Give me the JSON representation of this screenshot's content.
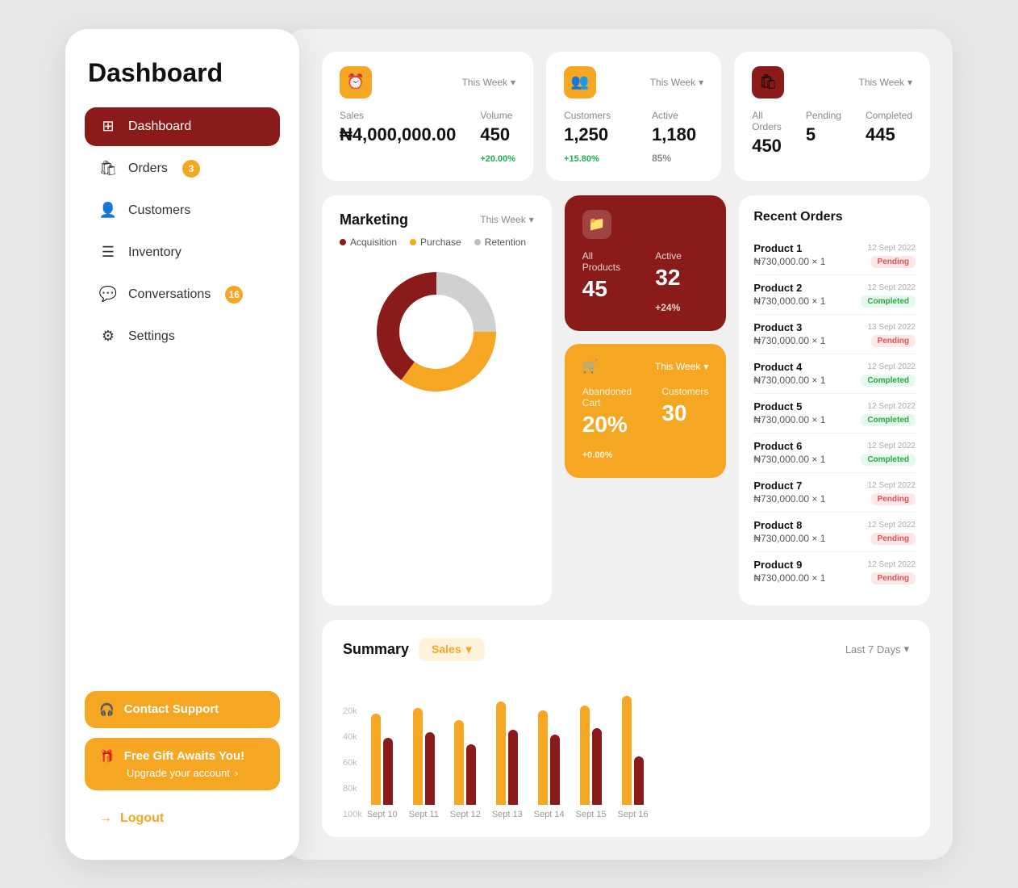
{
  "sidebar": {
    "title": "Dashboard",
    "nav_items": [
      {
        "id": "dashboard",
        "label": "Dashboard",
        "icon": "⊞",
        "active": true,
        "badge": null
      },
      {
        "id": "orders",
        "label": "Orders",
        "icon": "🛍",
        "active": false,
        "badge": "3"
      },
      {
        "id": "customers",
        "label": "Customers",
        "icon": "👤",
        "active": false,
        "badge": null
      },
      {
        "id": "inventory",
        "label": "Inventory",
        "icon": "☰",
        "active": false,
        "badge": null
      },
      {
        "id": "conversations",
        "label": "Conversations",
        "icon": "💬",
        "active": false,
        "badge": "16"
      },
      {
        "id": "settings",
        "label": "Settings",
        "icon": "⚙",
        "active": false,
        "badge": null
      }
    ],
    "contact_support_label": "Contact Support",
    "gift_title": "Free Gift Awaits You!",
    "gift_sub": "Upgrade your account",
    "gift_arrow": "›",
    "logout_label": "Logout"
  },
  "stats": {
    "sales_card": {
      "icon": "🕐",
      "period": "This Week",
      "sales_label": "Sales",
      "sales_value": "₦4,000,000.00",
      "volume_label": "Volume",
      "volume_value": "450",
      "volume_badge": "+20.00%"
    },
    "customers_card": {
      "icon": "👥",
      "period": "This Week",
      "customers_label": "Customers",
      "customers_value": "1,250",
      "customers_badge": "+15.80%",
      "active_label": "Active",
      "active_value": "1,180",
      "active_pct": "85%"
    },
    "orders_card": {
      "icon": "🛍",
      "period": "This Week",
      "all_orders_label": "All Orders",
      "all_orders_value": "450",
      "pending_label": "Pending",
      "pending_value": "5",
      "completed_label": "Completed",
      "completed_value": "445"
    }
  },
  "marketing": {
    "title": "Marketing",
    "period": "This Week",
    "legend": [
      {
        "label": "Acquisition",
        "color": "#8B1A1A"
      },
      {
        "label": "Purchase",
        "color": "#F5A623"
      },
      {
        "label": "Retention",
        "color": "#c0c0c0"
      }
    ],
    "donut": {
      "acquisition_pct": 40,
      "purchase_pct": 35,
      "retention_pct": 25
    }
  },
  "products_card": {
    "all_products_label": "All Products",
    "all_products_value": "45",
    "active_label": "Active",
    "active_value": "32",
    "active_badge": "+24%"
  },
  "abandoned_card": {
    "period": "This Week",
    "abandoned_label": "Abandoned Cart",
    "abandoned_value": "20%",
    "abandoned_badge": "+0.00%",
    "customers_label": "Customers",
    "customers_value": "30"
  },
  "recent_orders": {
    "title": "Recent Orders",
    "orders": [
      {
        "name": "Product 1",
        "price": "₦730,000.00 × 1",
        "date": "12 Sept 2022",
        "status": "Pending"
      },
      {
        "name": "Product 2",
        "price": "₦730,000.00 × 1",
        "date": "12 Sept 2022",
        "status": "Completed"
      },
      {
        "name": "Product 3",
        "price": "₦730,000.00 × 1",
        "date": "13 Sept 2022",
        "status": "Pending"
      },
      {
        "name": "Product 4",
        "price": "₦730,000.00 × 1",
        "date": "12 Sept 2022",
        "status": "Completed"
      },
      {
        "name": "Product 5",
        "price": "₦730,000.00 × 1",
        "date": "12 Sept 2022",
        "status": "Completed"
      },
      {
        "name": "Product 6",
        "price": "₦730,000.00 × 1",
        "date": "12 Sept 2022",
        "status": "Completed"
      },
      {
        "name": "Product 7",
        "price": "₦730,000.00 × 1",
        "date": "12 Sept 2022",
        "status": "Pending"
      },
      {
        "name": "Product 8",
        "price": "₦730,000.00 × 1",
        "date": "12 Sept 2022",
        "status": "Pending"
      },
      {
        "name": "Product 9",
        "price": "₦730,000.00 × 1",
        "date": "12 Sept 2022",
        "status": "Pending"
      }
    ]
  },
  "summary": {
    "title": "Summary",
    "tab_label": "Sales",
    "period_label": "Last 7 Days",
    "y_labels": [
      "100k",
      "80k",
      "60k",
      "40k",
      "20k",
      ""
    ],
    "bars": [
      {
        "label": "Sept 10",
        "primary": 75,
        "secondary": 55
      },
      {
        "label": "Sept 11",
        "primary": 80,
        "secondary": 60
      },
      {
        "label": "Sept 12",
        "primary": 70,
        "secondary": 50
      },
      {
        "label": "Sept 13",
        "primary": 85,
        "secondary": 62
      },
      {
        "label": "Sept 14",
        "primary": 78,
        "secondary": 58
      },
      {
        "label": "Sept 15",
        "primary": 82,
        "secondary": 63
      },
      {
        "label": "Sept 16",
        "primary": 90,
        "secondary": 40
      }
    ]
  },
  "icons": {
    "chevron_down": "▾",
    "arrow_right": "›",
    "headphones": "🎧",
    "gift": "🎁",
    "logout": "→",
    "cart": "🛒",
    "folder": "📁"
  }
}
